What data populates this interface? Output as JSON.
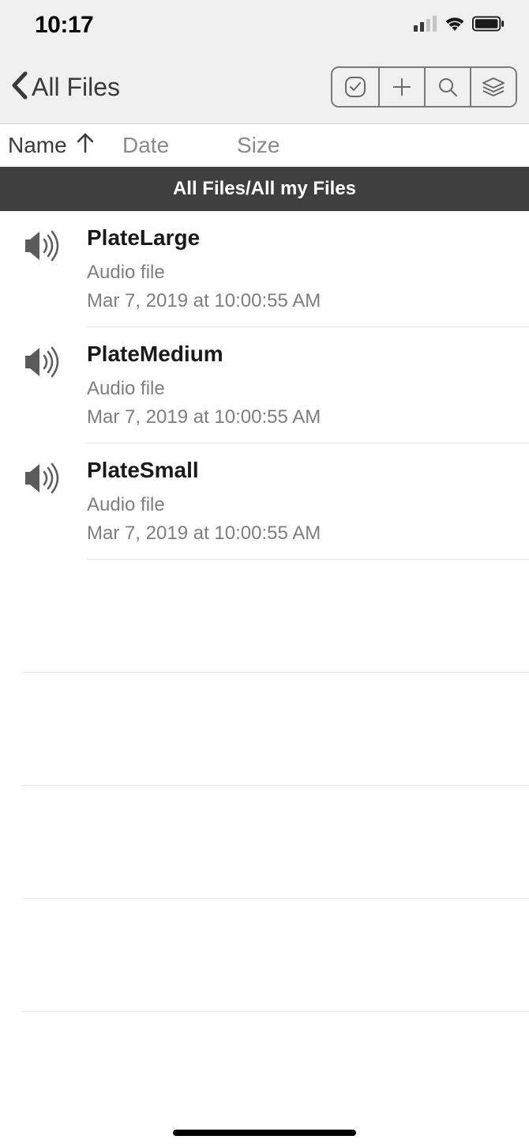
{
  "status": {
    "time": "10:17"
  },
  "nav": {
    "back_label": "All Files"
  },
  "sort": {
    "name": "Name",
    "date": "Date",
    "size": "Size"
  },
  "section": {
    "title": "All Files/All my Files"
  },
  "files": [
    {
      "name": "PlateLarge",
      "type": "Audio file",
      "date": "Mar 7, 2019 at 10:00:55 AM"
    },
    {
      "name": "PlateMedium",
      "type": "Audio file",
      "date": "Mar 7, 2019 at 10:00:55 AM"
    },
    {
      "name": "PlateSmall",
      "type": "Audio file",
      "date": "Mar 7, 2019 at 10:00:55 AM"
    }
  ]
}
